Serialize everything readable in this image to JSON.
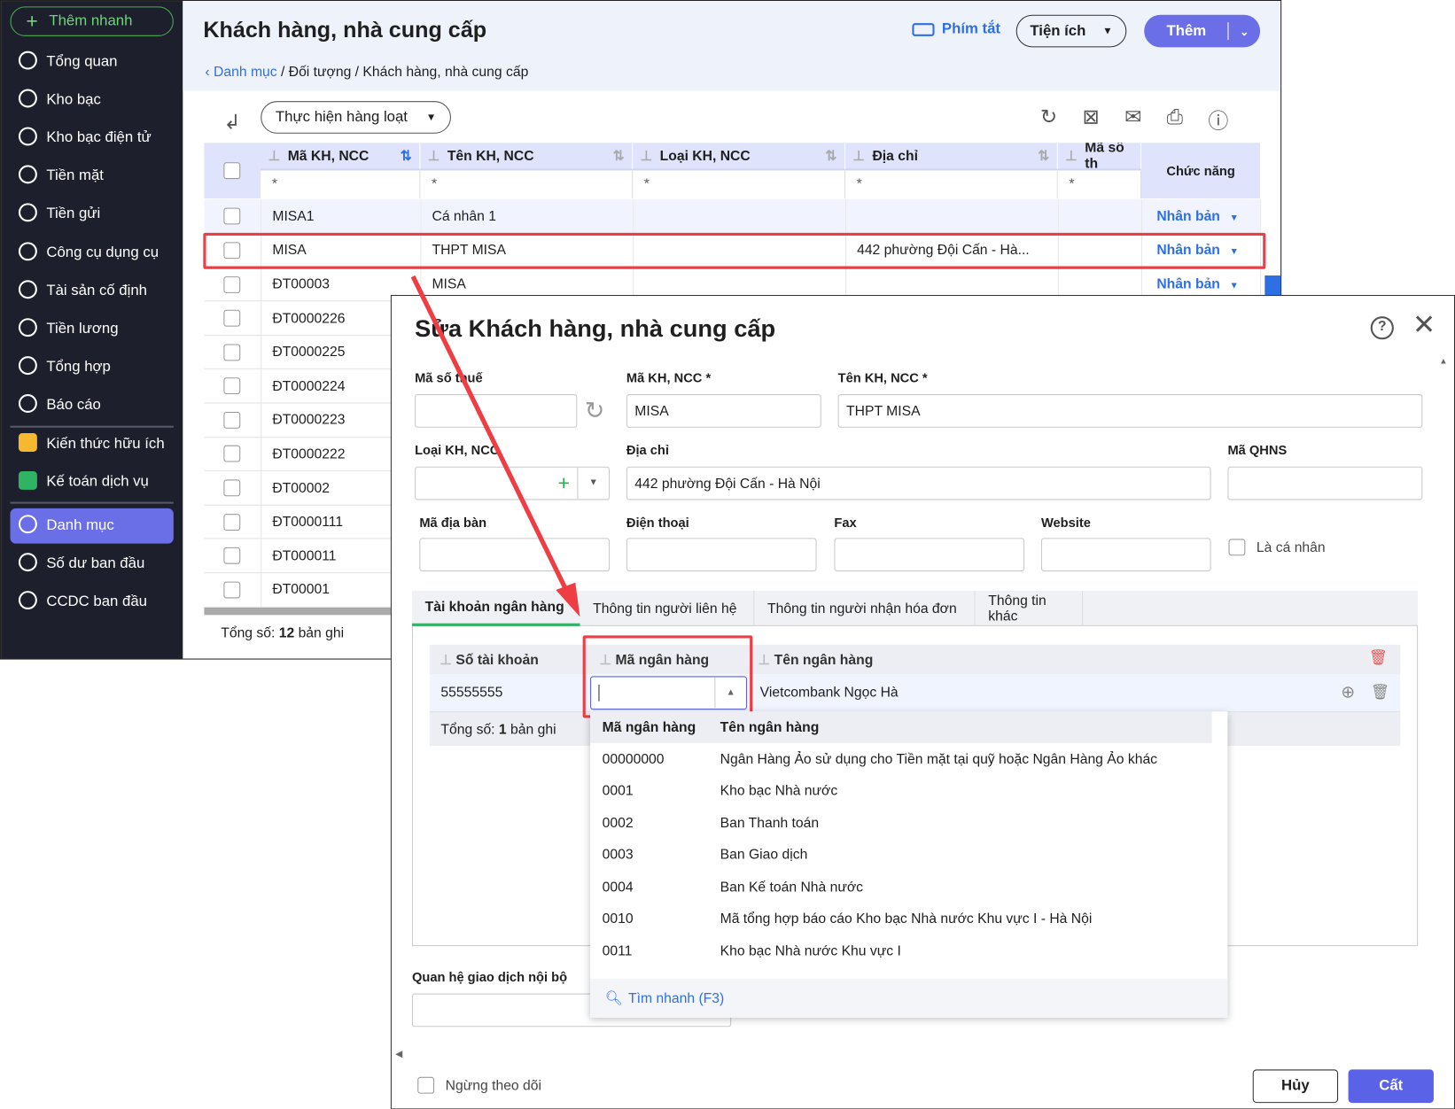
{
  "sidebar": {
    "quick_add": "Thêm nhanh",
    "items": [
      {
        "label": "Tổng quan",
        "icon": "pie-chart-icon"
      },
      {
        "label": "Kho bạc",
        "icon": "money-bag-icon"
      },
      {
        "label": "Kho bạc điện tử",
        "icon": "e-treasury-icon"
      },
      {
        "label": "Tiền mặt",
        "icon": "cash-icon"
      },
      {
        "label": "Tiền gửi",
        "icon": "deposit-icon"
      },
      {
        "label": "Công cụ dụng cụ",
        "icon": "tools-icon"
      },
      {
        "label": "Tài sản cố định",
        "icon": "truck-icon"
      },
      {
        "label": "Tiền lương",
        "icon": "salary-icon"
      },
      {
        "label": "Tổng hợp",
        "icon": "summary-icon"
      },
      {
        "label": "Báo cáo",
        "icon": "report-icon"
      },
      {
        "label": "Kiến thức hữu ích",
        "icon": "knowledge-icon"
      },
      {
        "label": "Kế toán dịch vụ",
        "icon": "service-icon"
      },
      {
        "label": "Danh mục",
        "icon": "catalog-icon"
      },
      {
        "label": "Số dư ban đầu",
        "icon": "balance-icon"
      },
      {
        "label": "CCDC ban đầu",
        "icon": "tools-initial-icon"
      }
    ]
  },
  "header": {
    "title": "Khách hàng, nhà cung cấp",
    "breadcrumb": {
      "root": "Danh mục",
      "rest": " / Đối tượng / Khách hàng, nhà cung cấp"
    },
    "shortcuts": "Phím tắt",
    "utilities": "Tiện ích",
    "add": "Thêm"
  },
  "toolbar": {
    "batch": "Thực hiện hàng loạt"
  },
  "grid": {
    "columns": [
      "Mã KH, NCC",
      "Tên KH, NCC",
      "Loại KH, NCC",
      "Địa chỉ",
      "Mã số th",
      "Chức năng"
    ],
    "filter": "*",
    "rows": [
      {
        "code": "MISA1",
        "name": "Cá nhân 1",
        "address": "",
        "action": "Nhân bản"
      },
      {
        "code": "MISA",
        "name": "THPT MISA",
        "address": "442 phường Đội Cấn - Hà...",
        "action": "Nhân bản"
      },
      {
        "code": "ĐT00003",
        "name": "MISA",
        "address": "",
        "action": "Nhân bản"
      },
      {
        "code": "ĐT0000226"
      },
      {
        "code": "ĐT0000225"
      },
      {
        "code": "ĐT0000224"
      },
      {
        "code": "ĐT0000223"
      },
      {
        "code": "ĐT0000222"
      },
      {
        "code": "ĐT00002"
      },
      {
        "code": "ĐT0000111"
      },
      {
        "code": "ĐT000011"
      },
      {
        "code": "ĐT00001"
      }
    ],
    "total_label": "Tổng số: ",
    "total": "12",
    "total_suffix": " bản ghi"
  },
  "dialog": {
    "title": "Sửa Khách hàng, nhà cung cấp",
    "fields": {
      "tax_label": "Mã số thuế",
      "tax": "",
      "code_label": "Mã KH, NCC *",
      "code": "MISA",
      "name_label": "Tên KH, NCC *",
      "name": "THPT MISA",
      "type_label": "Loại KH, NCC",
      "address_label": "Địa chỉ",
      "address": "442 phường Đội Cấn - Hà Nội",
      "qhns_label": "Mã QHNS",
      "area_label": "Mã địa bàn",
      "phone_label": "Điện thoại",
      "fax_label": "Fax",
      "website_label": "Website",
      "individual_label": "Là cá nhân",
      "relation_label": "Quan hệ giao dịch nội bộ"
    },
    "tabs": [
      "Tài khoản ngân hàng",
      "Thông tin người liên hệ",
      "Thông tin người nhận hóa đơn",
      "Thông tin khác"
    ],
    "bank_grid": {
      "columns": [
        "Số tài khoản",
        "Mã ngân hàng",
        "Tên ngân hàng"
      ],
      "row": {
        "account": "55555555",
        "bank_code": "",
        "bank_name": "Vietcombank Ngọc Hà"
      },
      "total_label": "Tổng số: ",
      "total": "1",
      "total_suffix": " bản ghi"
    },
    "dropdown": {
      "columns": [
        "Mã ngân hàng",
        "Tên ngân hàng"
      ],
      "rows": [
        {
          "code": "00000000",
          "name": "Ngân Hàng Ảo sử dụng cho Tiền mặt tại quỹ hoặc Ngân Hàng Ảo khác"
        },
        {
          "code": "0001",
          "name": "Kho bạc Nhà nước"
        },
        {
          "code": "0002",
          "name": "Ban Thanh toán"
        },
        {
          "code": "0003",
          "name": "Ban Giao dịch"
        },
        {
          "code": "0004",
          "name": "Ban Kế toán Nhà nước"
        },
        {
          "code": "0010",
          "name": "Mã tổng hợp báo cáo Kho bạc Nhà nước Khu vực I - Hà Nội"
        },
        {
          "code": "0011",
          "name": "Kho bạc Nhà nước Khu vực I"
        }
      ],
      "quick_search": "Tìm nhanh (F3)"
    },
    "footer": {
      "stop_tracking": "Ngừng theo dõi",
      "cancel": "Hủy",
      "save": "Cất"
    }
  }
}
